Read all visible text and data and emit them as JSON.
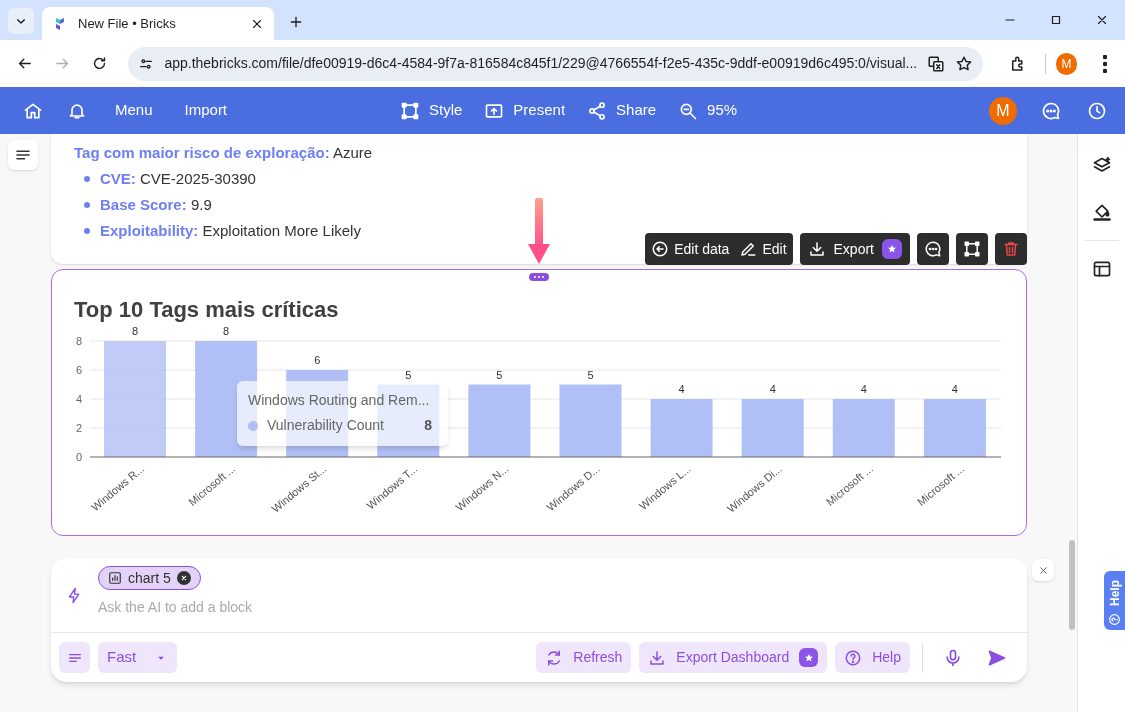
{
  "browser": {
    "tab_title": "New File • Bricks",
    "url": "app.thebricks.com/file/dfe00919-d6c4-4584-9f7a-816584c845f1/229@4766554f-f2e5-435c-9ddf-e00919d6c495:0/visual...",
    "profile_initial": "M"
  },
  "app_toolbar": {
    "menu_items": [
      "Menu",
      "Import"
    ],
    "center_items": [
      "Style",
      "Present",
      "Share"
    ],
    "zoom": "95%",
    "user_initial": "M"
  },
  "text_block": {
    "heading": "**Tag com maior risco de exploração:** Azure",
    "bullets": [
      "**CVE:** CVE-2025-30390",
      "**Base Score:** 9.9",
      "**Exploitability:** Exploitation More Likely"
    ]
  },
  "block_toolbar": {
    "buttons": [
      {
        "label": "Edit data",
        "premium": false
      },
      {
        "label": "Edit",
        "premium": false
      },
      {
        "label": "Export",
        "premium": true
      }
    ]
  },
  "chart_block": {
    "chart_data": {
      "type": "bar",
      "title": "Top 10 Tags mais críticas",
      "categories": [
        "Windows R...",
        "Microsoft ...",
        "Windows St...",
        "Windows T...",
        "Windows N...",
        "Windows D...",
        "Windows L...",
        "Windows Di...",
        "Microsoft ...",
        "Microsoft ..."
      ],
      "series": [
        {
          "name": "Vulnerability Count",
          "color": "#b0bff5",
          "values": [
            8,
            8,
            6,
            5,
            5,
            5,
            4,
            4,
            4,
            4
          ]
        }
      ],
      "ylim": [
        0,
        8
      ],
      "yticks": [
        0,
        2,
        4,
        6,
        8
      ],
      "grid": true,
      "data_labels": true
    },
    "bars": [
      {
        "hovered": true
      },
      {
        "hovered": false
      },
      {
        "hovered": false
      },
      {
        "hovered": false
      },
      {
        "hovered": false
      },
      {
        "hovered": false
      },
      {
        "hovered": false
      },
      {
        "hovered": false
      },
      {
        "hovered": false
      },
      {
        "hovered": false
      }
    ],
    "tooltip": {
      "title": "Windows Routing and Rem...",
      "value": "8"
    }
  },
  "ai_prompt": {
    "chip": "chart 5",
    "placeholder": "Ask the AI to add a block",
    "mode": "Fast",
    "buttons": [
      {
        "label": "Refresh",
        "premium": false
      },
      {
        "label": "Export Dashboard",
        "premium": true
      },
      {
        "label": "Help",
        "premium": false
      }
    ]
  },
  "help_tab": "Help"
}
